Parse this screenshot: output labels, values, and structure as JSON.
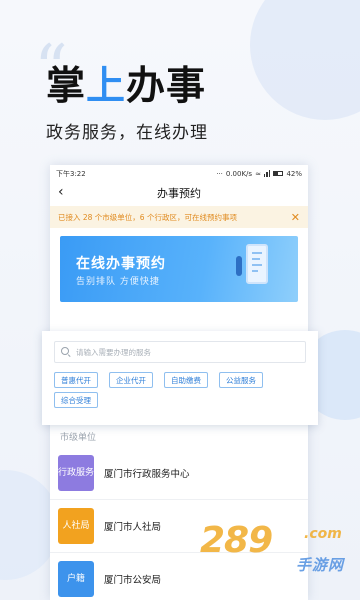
{
  "promo": {
    "title_a": "掌",
    "title_b": "上",
    "title_c": "办事",
    "subtitle": "政务服务，在线办理"
  },
  "statusbar": {
    "time": "下午3:22",
    "net_speed": "0.00K/s",
    "battery": "42%"
  },
  "navbar": {
    "back_icon": "‹",
    "title": "办事预约"
  },
  "notice": {
    "text": "已接入 28 个市级单位，6 个行政区，可在线预约事项",
    "close_icon": "✕"
  },
  "banner": {
    "title": "在线办事预约",
    "subtitle": "告别排队  方便快捷"
  },
  "search": {
    "placeholder": "请输入需要办理的服务"
  },
  "chips": [
    "普惠代开",
    "企业代开",
    "自助缴费",
    "公益服务",
    "综合受理"
  ],
  "section_label": "市级单位",
  "list": [
    {
      "icon_text": "行政服务",
      "label": "厦门市行政服务中心",
      "color": "#8d7be0"
    },
    {
      "icon_text": "人社局",
      "label": "厦门市人社局",
      "color": "#f2a21f"
    },
    {
      "icon_text": "户籍",
      "label": "厦门市公安局",
      "color": "#3d93ec"
    }
  ],
  "watermark": {
    "num": "289",
    "com": ".com",
    "cn": "手游网"
  }
}
